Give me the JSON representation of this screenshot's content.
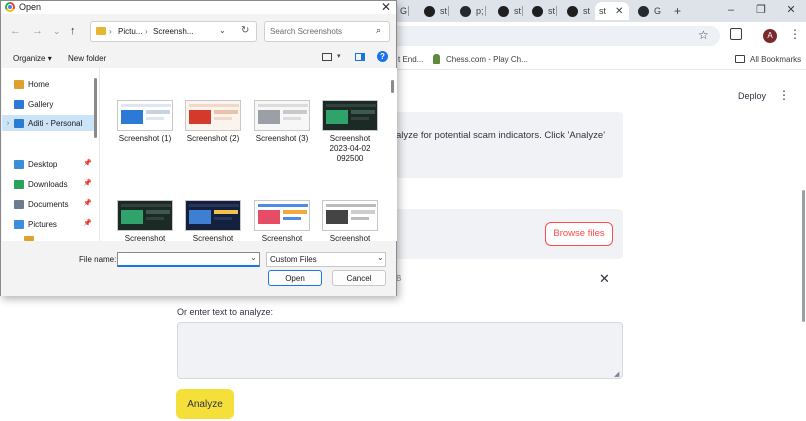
{
  "browser": {
    "tabs": [
      {
        "label": "G",
        "icon": "google-icon"
      },
      {
        "label": "st",
        "icon": "streamlit-icon"
      },
      {
        "label": "p;",
        "icon": "github-icon"
      },
      {
        "label": "st",
        "icon": "streamlit-icon"
      },
      {
        "label": "st",
        "icon": "streamlit-icon"
      },
      {
        "label": "st",
        "icon": "streamlit-icon"
      },
      {
        "label": "st",
        "icon": "streamlit-icon",
        "active": true
      },
      {
        "label": "G",
        "icon": "github-icon"
      }
    ],
    "new_tab": "+",
    "window_controls": [
      "–",
      "❐",
      "✕"
    ],
    "profile_initial": "A",
    "bookmarks": {
      "partial": "t End...",
      "chess": "Chess.com - Play Ch...",
      "all": "All Bookmarks"
    }
  },
  "app": {
    "deploy": "Deploy",
    "info_text_1": "alyze for potential scam indicators. Click 'Analyze'",
    "info_text_2": "",
    "browse_button": "Browse files",
    "file_hint": "B",
    "text_label": "Or enter text to analyze:",
    "text_value": "",
    "analyze_button": "Analyze"
  },
  "dialog": {
    "title": "Open",
    "address": {
      "part1": "Pictu...",
      "part2": "Screensh..."
    },
    "search_placeholder": "Search Screenshots",
    "organize": "Organize",
    "new_folder": "New folder",
    "nav_items": [
      {
        "label": "Home",
        "icon": "home-icon",
        "color": "#e0a030"
      },
      {
        "label": "Gallery",
        "icon": "gallery-icon",
        "color": "#2b7bd6"
      },
      {
        "label": "Aditi - Personal",
        "icon": "onedrive-icon",
        "color": "#2b7bd6",
        "selected": true,
        "expandable": true
      },
      {
        "label": "Desktop",
        "icon": "desktop-icon",
        "color": "#3a8fd8",
        "pinned": true
      },
      {
        "label": "Downloads",
        "icon": "download-icon",
        "color": "#2aa35a",
        "pinned": true
      },
      {
        "label": "Documents",
        "icon": "documents-icon",
        "color": "#6b7c8f",
        "pinned": true
      },
      {
        "label": "Pictures",
        "icon": "pictures-icon",
        "color": "#3a8fd8",
        "pinned": true
      }
    ],
    "files": [
      {
        "label": "Screenshot (1)",
        "theme": "light-blue"
      },
      {
        "label": "Screenshot (2)",
        "theme": "light-red"
      },
      {
        "label": "Screenshot (3)",
        "theme": "light-grey"
      },
      {
        "label": "Screenshot\n2023-04-02\n092500",
        "theme": "dark-green"
      },
      {
        "label": "Screenshot",
        "theme": "dark-green"
      },
      {
        "label": "Screenshot",
        "theme": "dark-slides"
      },
      {
        "label": "Screenshot",
        "theme": "light-colorful"
      },
      {
        "label": "Screenshot",
        "theme": "light-doc"
      }
    ],
    "file_name_label": "File name:",
    "file_name_value": "",
    "file_type": "Custom Files",
    "open_button": "Open",
    "cancel_button": "Cancel"
  }
}
